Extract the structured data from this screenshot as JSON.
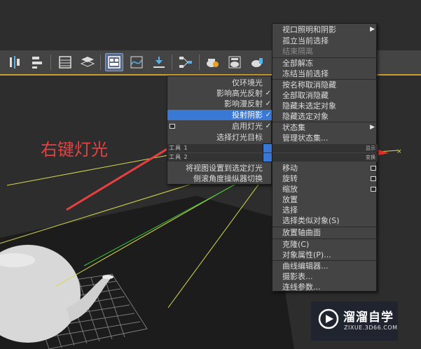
{
  "annotation": {
    "text": "右键灯光",
    "color": "#e84040"
  },
  "toolbar": {
    "buttons": [
      {
        "name": "align-icon",
        "active": false
      },
      {
        "name": "layer-align-icon",
        "active": false
      },
      {
        "name": "scene-explorer-icon",
        "active": false
      },
      {
        "name": "layer-manager-icon",
        "active": false
      },
      {
        "name": "ribbon-toggle-icon",
        "active": true
      },
      {
        "name": "curve-editor-icon",
        "active": false
      },
      {
        "name": "dope-sheet-icon",
        "active": false
      },
      {
        "name": "schematic-view-icon",
        "active": false
      },
      {
        "name": "material-editor-icon",
        "active": false
      },
      {
        "name": "render-setup-icon",
        "active": false
      },
      {
        "name": "render-frame-icon",
        "active": false
      }
    ]
  },
  "left_menu": {
    "header": {
      "label": "工具 1",
      "right_label": "显示"
    },
    "items": [
      {
        "label": "仅环境光",
        "checked": false
      },
      {
        "label": "影响高光反射",
        "checked": true
      },
      {
        "label": "影响漫反射",
        "checked": true
      },
      {
        "label": "投射阴影",
        "checked": true,
        "selected": true
      },
      {
        "label": "启用灯光",
        "checked": true,
        "has_box": true
      },
      {
        "label": "选择灯光目标",
        "checked": false
      }
    ],
    "header2": {
      "label": "工具 2",
      "right_label": "变换"
    },
    "items2": [
      {
        "label": "将视图设置到选定灯光"
      },
      {
        "label": "侧滚角度操纵器切换"
      }
    ]
  },
  "right_menu": {
    "group1": [
      {
        "label": "视口照明和阴影",
        "submenu": true
      },
      {
        "label": "孤立当前选择"
      },
      {
        "label": "结束隔离",
        "disabled": true
      },
      {
        "label": "全部解冻"
      },
      {
        "label": "冻结当前选择"
      },
      {
        "label": "按名称取消隐藏"
      },
      {
        "label": "全部取消隐藏"
      },
      {
        "label": "隐藏未选定对象"
      },
      {
        "label": "隐藏选定对象"
      },
      {
        "label": "状态集",
        "submenu": true
      },
      {
        "label": "管理状态集..."
      }
    ],
    "group2": [
      {
        "label": "移动",
        "box": true
      },
      {
        "label": "旋转",
        "box": true
      },
      {
        "label": "缩放",
        "box": true
      },
      {
        "label": "放置"
      },
      {
        "label": "选择"
      },
      {
        "label": "选择类似对象(S)"
      },
      {
        "label": "放置轴曲面"
      },
      {
        "label": "克隆(C)"
      },
      {
        "label": "对象属性(P)..."
      },
      {
        "label": "曲线编辑器..."
      },
      {
        "label": "摄影表..."
      },
      {
        "label": "连线参数..."
      }
    ]
  },
  "watermark": {
    "title": "溜溜自学",
    "url": "ZIXUE.3D66.COM"
  },
  "colors": {
    "accent": "#3a78d6",
    "menu_bg": "#444444",
    "annotation": "#e84040",
    "light_line": "#d8d84a"
  }
}
